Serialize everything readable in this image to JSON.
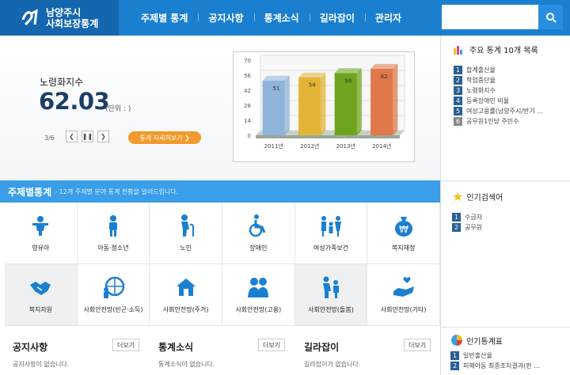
{
  "header": {
    "logo_line1": "남양주시",
    "logo_line2": "사회보장통계",
    "nav": [
      "주제별 통계",
      "공지사항",
      "통계소식",
      "길라잡이",
      "관리자"
    ]
  },
  "hero": {
    "label": "노령화지수",
    "value": "62.03",
    "unit": "(단위 : )",
    "pager": "3/6",
    "detail_button": "통계 자세히보기"
  },
  "chart_data": {
    "type": "bar",
    "categories": [
      "2011년",
      "2012년",
      "2013년",
      "2014년"
    ],
    "values": [
      51,
      54,
      58,
      62
    ],
    "ylim": [
      0,
      70
    ],
    "yticks": [
      0,
      14,
      28,
      42,
      56,
      70
    ],
    "colors": [
      "#8fb3d9",
      "#e3b436",
      "#6fa51e",
      "#e0784a"
    ],
    "title": "",
    "xlabel": "",
    "ylabel": ""
  },
  "top10": {
    "title": "주요 통계 10개 목록",
    "items": [
      {
        "num": "1",
        "label": "합계출산율"
      },
      {
        "num": "2",
        "label": "학업중단율"
      },
      {
        "num": "3",
        "label": "노령화지수"
      },
      {
        "num": "4",
        "label": "등록장애인 비율"
      },
      {
        "num": "5",
        "label": "여성고용률(남양주시/반기 ..."
      },
      {
        "num": "6",
        "label": "공무원1인당 주민수"
      }
    ]
  },
  "band": {
    "title": "주제별통계",
    "desc": "- 12개 주제별 분야 통계 현황을 알려드립니다."
  },
  "categories": [
    {
      "label": "영유아",
      "icon": "baby-icon"
    },
    {
      "label": "아동·청소년",
      "icon": "youth-icon"
    },
    {
      "label": "노인",
      "icon": "elderly-icon"
    },
    {
      "label": "장애인",
      "icon": "wheelchair-icon"
    },
    {
      "label": "여성가족보건",
      "icon": "family-icon"
    },
    {
      "label": "복지재정",
      "icon": "money-bag-icon"
    },
    {
      "label": "복지자원",
      "icon": "handshake-icon"
    },
    {
      "label": "사회안전망(빈곤·소득)",
      "icon": "globe-people-icon"
    },
    {
      "label": "사회안전망(주거)",
      "icon": "house-icon"
    },
    {
      "label": "사회안전망(고용)",
      "icon": "workers-icon"
    },
    {
      "label": "사회안전망(돌봄)",
      "icon": "care-icon"
    },
    {
      "label": "사회안전망(기타)",
      "icon": "heart-hand-icon"
    }
  ],
  "popular_search": {
    "title": "인기검색어",
    "items": [
      {
        "num": "1",
        "label": "수급자"
      },
      {
        "num": "2",
        "label": "공무원"
      }
    ]
  },
  "popular_table": {
    "title": "인기통계표",
    "items": [
      {
        "num": "1",
        "label": "일반출산율"
      },
      {
        "num": "2",
        "label": "피해아동 최종조치결과(판 ..."
      }
    ]
  },
  "boards": [
    {
      "title": "공지사항",
      "more": "더보기",
      "empty": "공지사항이 없습니다."
    },
    {
      "title": "통계소식",
      "more": "더보기",
      "empty": "통계소식이 없습니다."
    },
    {
      "title": "길라잡이",
      "more": "더보기",
      "empty": "길라잡이가 없습니다."
    }
  ],
  "colors": {
    "header": "#1b7fd0",
    "logo_bg": "#1467ae",
    "band": "#3a9ee8",
    "icon": "#1b7fd0",
    "accent": "#f29a2c",
    "value": "#1b3d66"
  }
}
